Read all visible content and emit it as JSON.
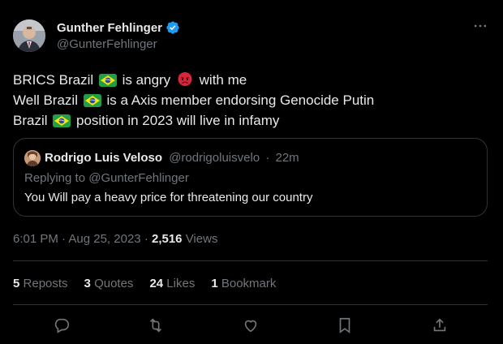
{
  "author": {
    "name": "Gunther Fehlinger",
    "handle": "@GunterFehlinger",
    "verified": true
  },
  "tweet": {
    "line1_a": "BRICS Brazil",
    "line1_b": "is angry",
    "line1_c": "with me",
    "line2_a": "Well Brazil",
    "line2_b": "is a Axis member endorsing Genocide Putin",
    "line3_a": "Brazil",
    "line3_b": "position in 2023 will live in infamy"
  },
  "quote": {
    "name": "Rodrigo Luis Veloso",
    "handle": "@rodrigoluisvelo",
    "separator": "·",
    "time": "22m",
    "replying_to": "Replying to @GunterFehlinger",
    "text": "You Will pay a heavy price for threatening our country"
  },
  "meta": {
    "time": "6:01 PM",
    "separator": "·",
    "date": "Aug 25, 2023",
    "views_count": "2,516",
    "views_label": "Views"
  },
  "stats": {
    "reposts_count": "5",
    "reposts_label": "Reposts",
    "quotes_count": "3",
    "quotes_label": "Quotes",
    "likes_count": "24",
    "likes_label": "Likes",
    "bookmarks_count": "1",
    "bookmarks_label": "Bookmark"
  },
  "icons": {
    "verified": "verified-badge-icon",
    "more": "more-options-icon",
    "flag": "brazil-flag-emoji",
    "angry": "angry-face-emoji",
    "reply": "reply-icon",
    "repost": "repost-icon",
    "like": "like-icon",
    "bookmark": "bookmark-icon",
    "share": "share-icon"
  },
  "colors": {
    "background": "#000000",
    "text": "#e7e9ea",
    "muted": "#71767b",
    "border": "#2f3336",
    "verified": "#1d9bf0"
  }
}
